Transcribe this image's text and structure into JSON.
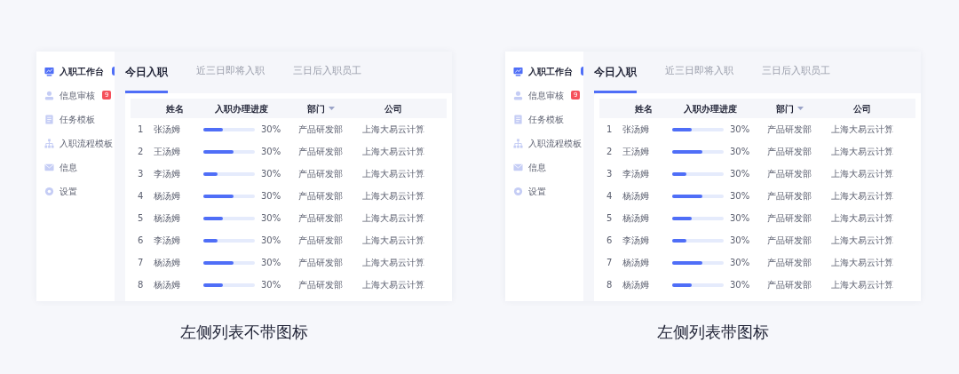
{
  "panels": [
    {
      "caption": "左侧列表不带图标",
      "sidebar": {
        "items": [
          {
            "label": "入职工作台",
            "selected": true
          },
          {
            "label": "信息审核",
            "selected": false,
            "badge": "9"
          },
          {
            "label": "任务模板",
            "selected": false
          },
          {
            "label": "入职流程模板",
            "selected": false
          },
          {
            "label": "信息",
            "selected": false
          },
          {
            "label": "设置",
            "selected": false
          }
        ]
      },
      "tabs": [
        {
          "label": "今日入职",
          "selected": true
        },
        {
          "label": "近三日即将入职",
          "selected": false
        },
        {
          "label": "三日后入职员工",
          "selected": false
        }
      ],
      "table": {
        "columns": [
          {
            "label": "姓名",
            "sortable": false
          },
          {
            "label": "入职办理进度",
            "sortable": false
          },
          {
            "label": "部门",
            "sortable": true
          },
          {
            "label": "公司",
            "sortable": false
          }
        ],
        "rows": [
          {
            "index": "1",
            "name": "张汤姆",
            "level": 0.38,
            "reading": "30%",
            "department": "产品研发部",
            "company": "上海大易云计算"
          },
          {
            "index": "2",
            "name": "王汤姆",
            "level": 0.58,
            "reading": "30%",
            "department": "产品研发部",
            "company": "上海大易云计算"
          },
          {
            "index": "3",
            "name": "李汤姆",
            "level": 0.27,
            "reading": "30%",
            "department": "产品研发部",
            "company": "上海大易云计算"
          },
          {
            "index": "4",
            "name": "杨汤姆",
            "level": 0.58,
            "reading": "30%",
            "department": "产品研发部",
            "company": "上海大易云计算"
          },
          {
            "index": "5",
            "name": "杨汤姆",
            "level": 0.38,
            "reading": "30%",
            "department": "产品研发部",
            "company": "上海大易云计算"
          },
          {
            "index": "6",
            "name": "李汤姆",
            "level": 0.27,
            "reading": "30%",
            "department": "产品研发部",
            "company": "上海大易云计算"
          },
          {
            "index": "7",
            "name": "杨汤姆",
            "level": 0.58,
            "reading": "30%",
            "department": "产品研发部",
            "company": "上海大易云计算"
          },
          {
            "index": "8",
            "name": "杨汤姆",
            "level": 0.38,
            "reading": "30%",
            "department": "产品研发部",
            "company": "上海大易云计算"
          }
        ]
      }
    },
    {
      "caption": "左侧列表带图标",
      "sidebar": {
        "items": [
          {
            "label": "入职工作台",
            "selected": true
          },
          {
            "label": "信息审核",
            "selected": false,
            "badge": "9"
          },
          {
            "label": "任务模板",
            "selected": false
          },
          {
            "label": "入职流程模板",
            "selected": false
          },
          {
            "label": "信息",
            "selected": false
          },
          {
            "label": "设置",
            "selected": false
          }
        ]
      },
      "tabs": [
        {
          "label": "今日入职",
          "selected": true
        },
        {
          "label": "近三日即将入职",
          "selected": false
        },
        {
          "label": "三日后入职员工",
          "selected": false
        }
      ],
      "table": {
        "columns": [
          {
            "label": "姓名",
            "sortable": false
          },
          {
            "label": "入职办理进度",
            "sortable": false
          },
          {
            "label": "部门",
            "sortable": true
          },
          {
            "label": "公司",
            "sortable": false
          }
        ],
        "rows": [
          {
            "index": "1",
            "name": "张汤姆",
            "level": 0.38,
            "reading": "30%",
            "department": "产品研发部",
            "company": "上海大易云计算"
          },
          {
            "index": "2",
            "name": "王汤姆",
            "level": 0.58,
            "reading": "30%",
            "department": "产品研发部",
            "company": "上海大易云计算"
          },
          {
            "index": "3",
            "name": "李汤姆",
            "level": 0.27,
            "reading": "30%",
            "department": "产品研发部",
            "company": "上海大易云计算"
          },
          {
            "index": "4",
            "name": "杨汤姆",
            "level": 0.58,
            "reading": "30%",
            "department": "产品研发部",
            "company": "上海大易云计算"
          },
          {
            "index": "5",
            "name": "杨汤姆",
            "level": 0.38,
            "reading": "30%",
            "department": "产品研发部",
            "company": "上海大易云计算"
          },
          {
            "index": "6",
            "name": "李汤姆",
            "level": 0.27,
            "reading": "30%",
            "department": "产品研发部",
            "company": "上海大易云计算"
          },
          {
            "index": "7",
            "name": "杨汤姆",
            "level": 0.58,
            "reading": "30%",
            "department": "产品研发部",
            "company": "上海大易云计算"
          },
          {
            "index": "8",
            "name": "杨汤姆",
            "level": 0.38,
            "reading": "30%",
            "department": "产品研发部",
            "company": "上海大易云计算"
          }
        ]
      }
    }
  ]
}
